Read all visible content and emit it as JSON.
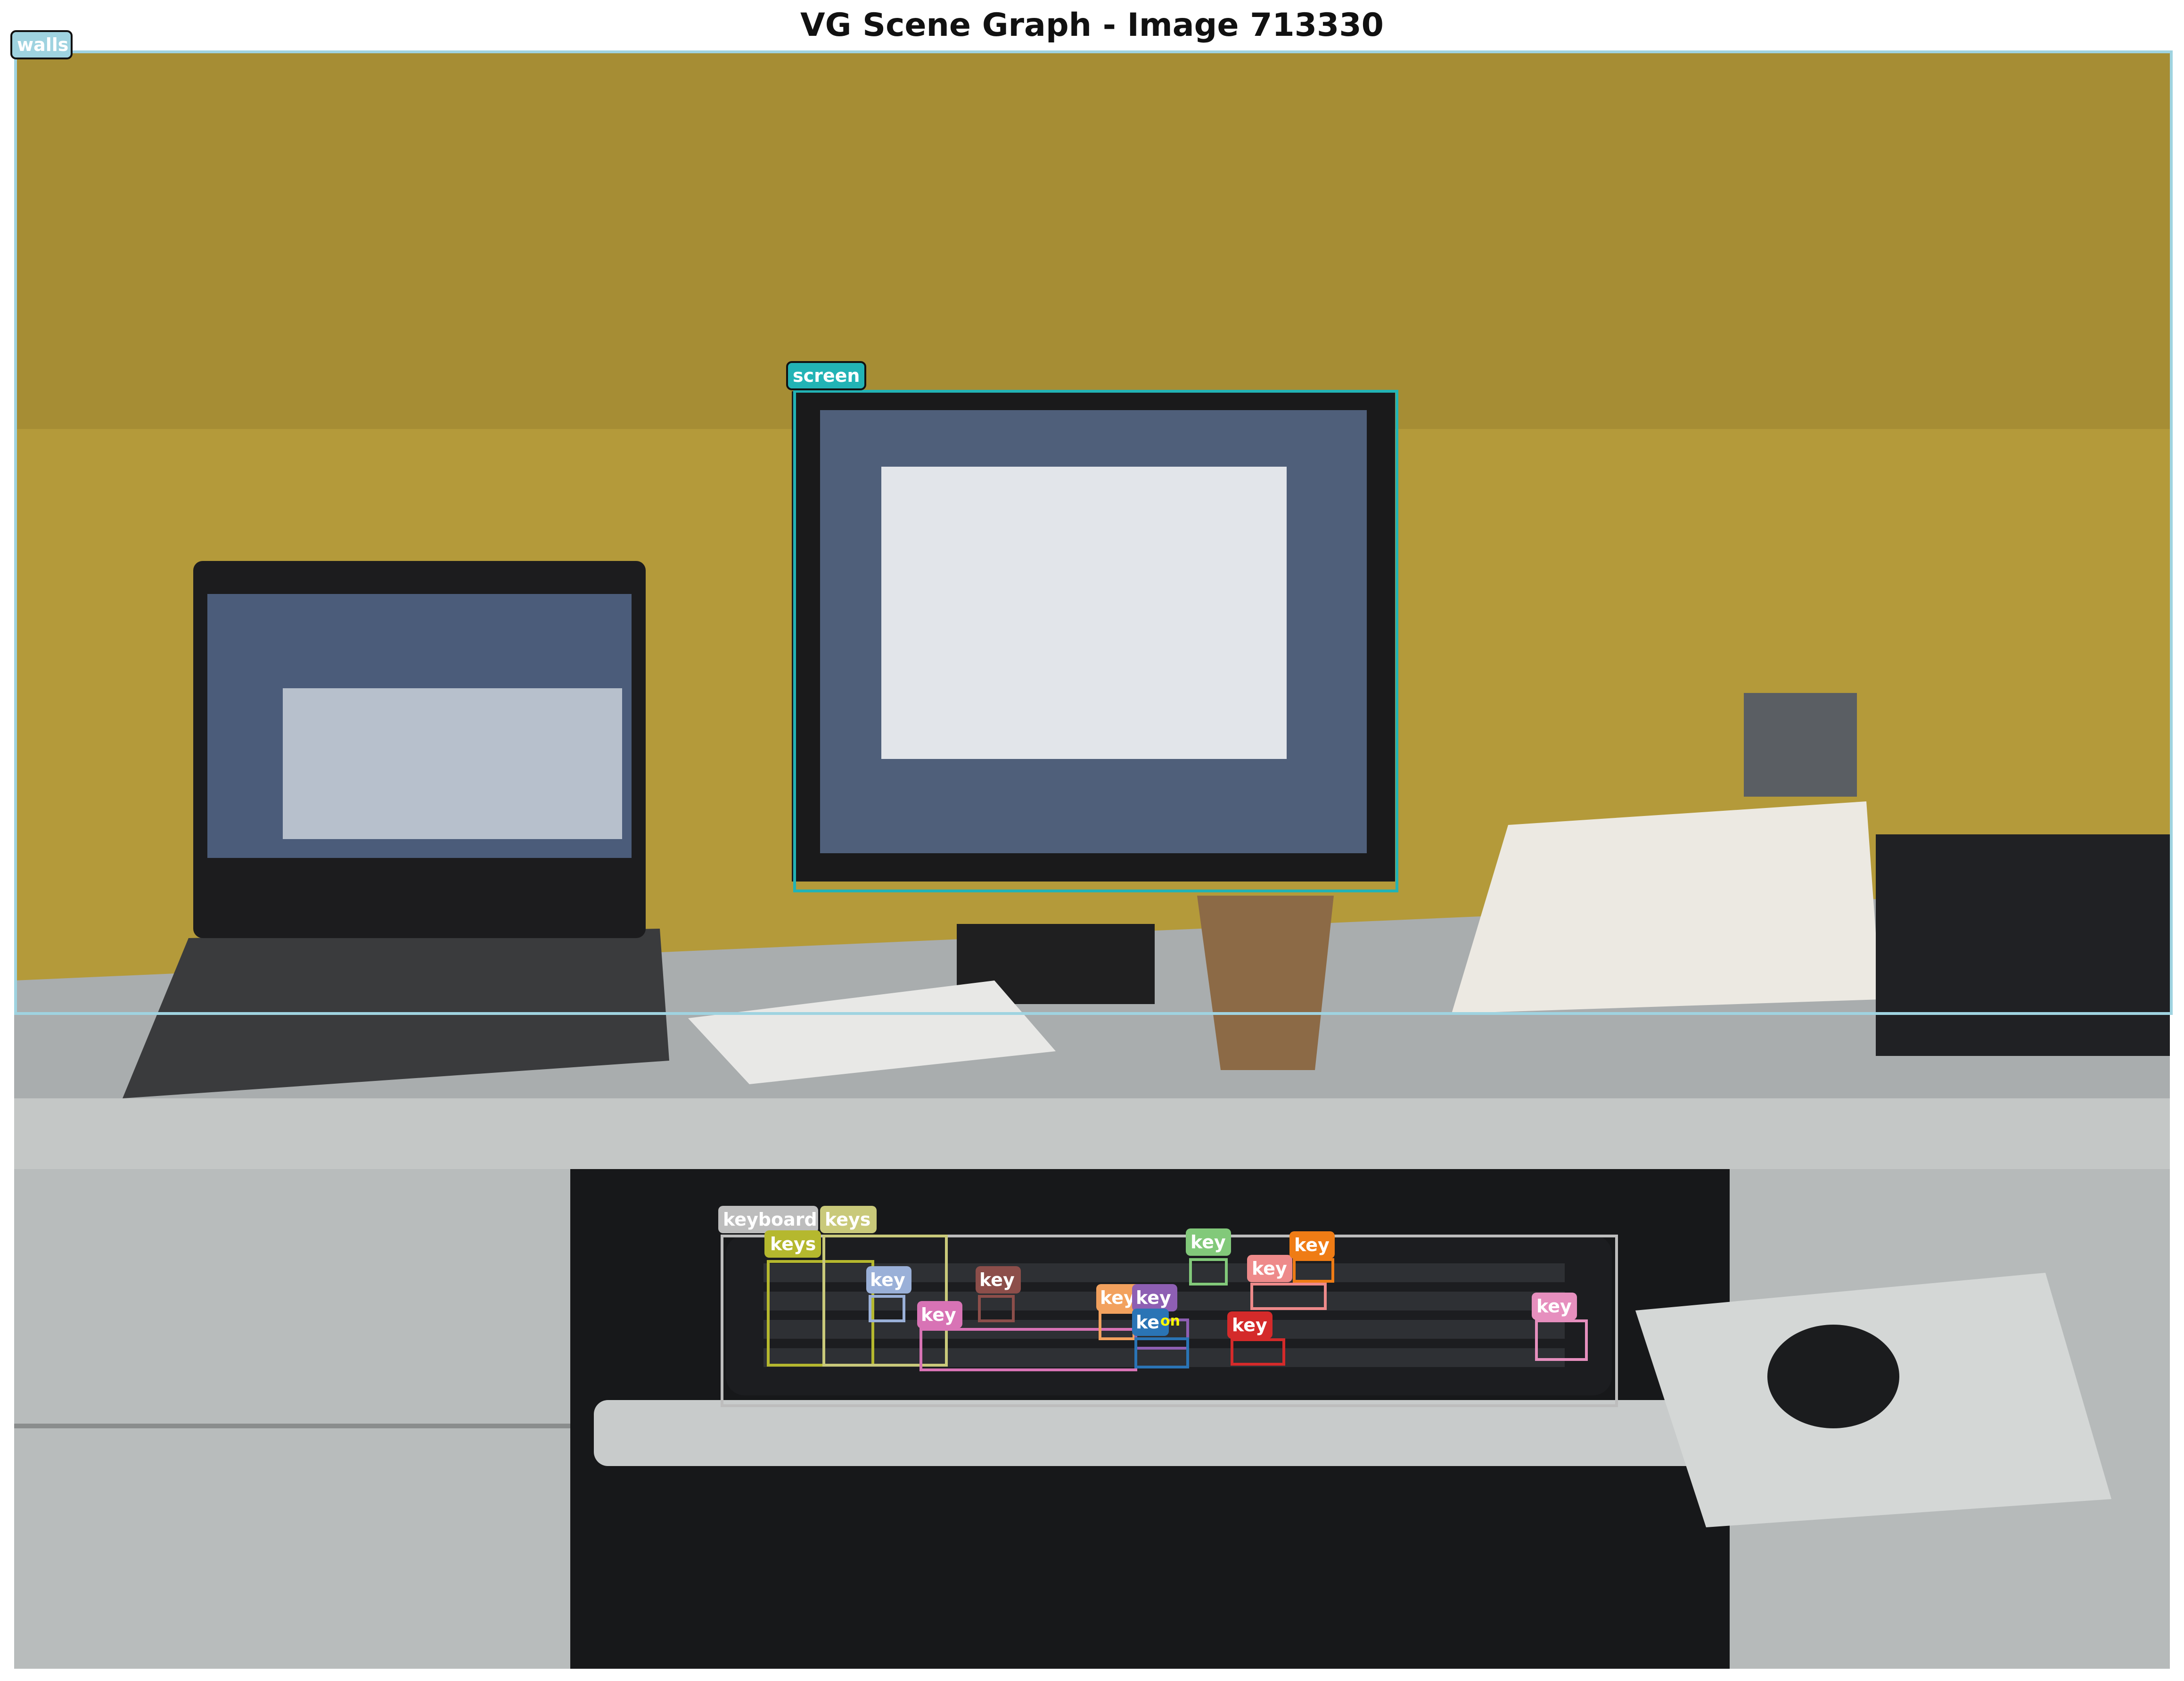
{
  "title": "VG Scene Graph - Image 713330",
  "regions": [
    {
      "label": "walls",
      "color": "#9fd3e0"
    },
    {
      "label": "screen",
      "color": "#22b3b5"
    },
    {
      "label": "keyboard",
      "color": "#bdbdbd"
    },
    {
      "label": "keys",
      "color": "#b5b82e"
    },
    {
      "label": "keys",
      "color": "#c9c97a"
    },
    {
      "label": "key",
      "color": "#9ab0d8"
    },
    {
      "label": "key",
      "color": "#8c4e4a"
    },
    {
      "label": "key",
      "color": "#d873b5"
    },
    {
      "label": "key",
      "color": "#f2a15e"
    },
    {
      "label": "key",
      "color": "#8e5fb3"
    },
    {
      "label": "ke",
      "color": "#2a74b5"
    },
    {
      "label": "on",
      "color": "#ffff00"
    },
    {
      "label": "key",
      "color": "#82c97a"
    },
    {
      "label": "key",
      "color": "#ee8a8a"
    },
    {
      "label": "key",
      "color": "#ef7c15"
    },
    {
      "label": "key",
      "color": "#d42a2a"
    },
    {
      "label": "key",
      "color": "#e68fbe"
    }
  ]
}
